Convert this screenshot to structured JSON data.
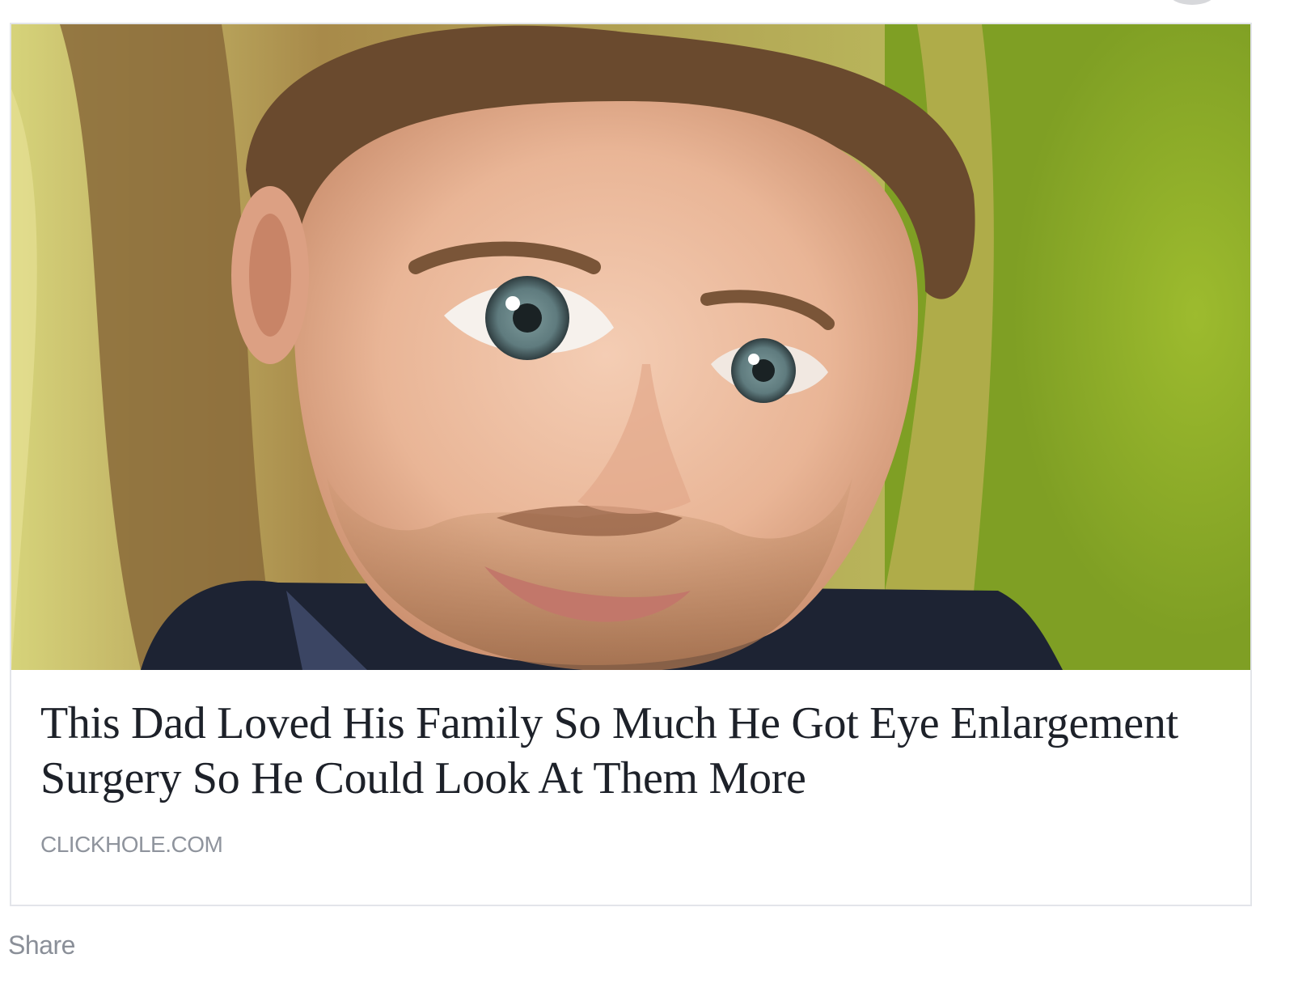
{
  "link_preview": {
    "image_alt": "Man with enlarged eyes",
    "headline": "This Dad Loved His Family So Much He Got Eye Enlargement Surgery So He Could Look At Them More",
    "domain": "CLICKHOLE.COM"
  },
  "actions": {
    "share_label": "Share"
  }
}
